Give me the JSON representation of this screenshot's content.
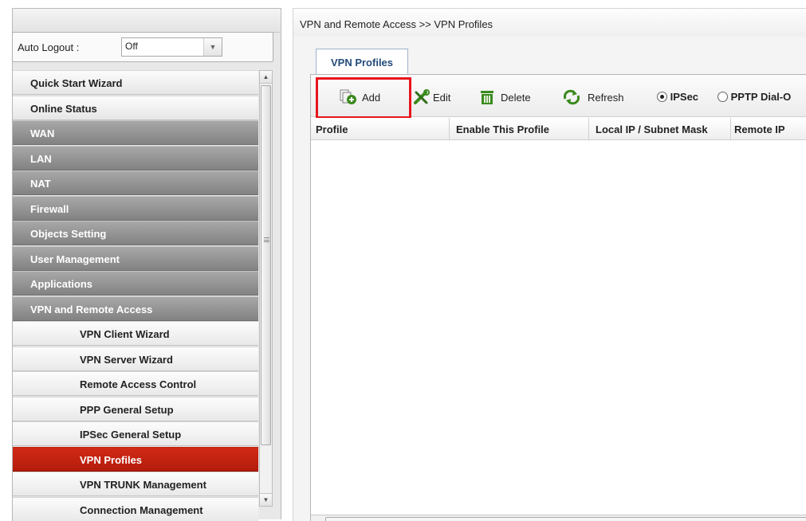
{
  "sidebar": {
    "auto_logout": {
      "label": "Auto Logout :",
      "value": "Off"
    },
    "menu": [
      {
        "label": "Quick Start Wizard",
        "style": "light"
      },
      {
        "label": "Online Status",
        "style": "light"
      },
      {
        "label": "WAN",
        "style": "dark"
      },
      {
        "label": "LAN",
        "style": "dark"
      },
      {
        "label": "NAT",
        "style": "dark"
      },
      {
        "label": "Firewall",
        "style": "dark"
      },
      {
        "label": "Objects Setting",
        "style": "dark"
      },
      {
        "label": "User Management",
        "style": "dark"
      },
      {
        "label": "Applications",
        "style": "dark"
      },
      {
        "label": "VPN and Remote Access",
        "style": "dark"
      },
      {
        "label": "VPN Client Wizard",
        "style": "sub"
      },
      {
        "label": "VPN Server Wizard",
        "style": "sub"
      },
      {
        "label": "Remote Access Control",
        "style": "sub"
      },
      {
        "label": "PPP General Setup",
        "style": "sub"
      },
      {
        "label": "IPSec General Setup",
        "style": "sub"
      },
      {
        "label": "VPN Profiles",
        "style": "sub",
        "active": true
      },
      {
        "label": "VPN TRUNK Management",
        "style": "sub"
      },
      {
        "label": "Connection Management",
        "style": "sub"
      }
    ]
  },
  "main": {
    "breadcrumb": "VPN and Remote Access >> VPN Profiles",
    "tab": "VPN Profiles",
    "toolbar": {
      "add": "Add",
      "edit": "Edit",
      "delete": "Delete",
      "refresh": "Refresh",
      "radio_ipsec": "IPSec",
      "radio_pptp": "PPTP Dial-O"
    },
    "columns": [
      "Profile",
      "Enable This Profile",
      "Local IP / Subnet Mask",
      "Remote IP"
    ]
  },
  "colors": {
    "highlight": "#e8141c",
    "active_menu": "#c4210f",
    "section_menu": "#959595",
    "icon_green": "#3a8a1e"
  }
}
